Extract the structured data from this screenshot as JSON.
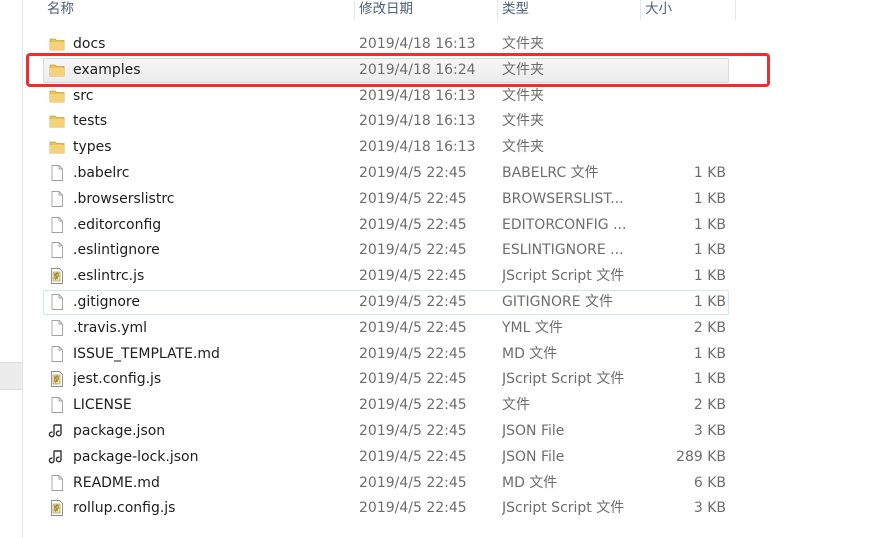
{
  "columns": {
    "name": "名称",
    "date": "修改日期",
    "type": "类型",
    "size": "大小"
  },
  "files": [
    {
      "name": "docs",
      "date": "2019/4/18 16:13",
      "type": "文件夹",
      "size": "",
      "icon": "folder-icon",
      "state": "normal"
    },
    {
      "name": "examples",
      "date": "2019/4/18 16:24",
      "type": "文件夹",
      "size": "",
      "icon": "folder-icon",
      "state": "selected"
    },
    {
      "name": "src",
      "date": "2019/4/18 16:13",
      "type": "文件夹",
      "size": "",
      "icon": "folder-icon",
      "state": "normal"
    },
    {
      "name": "tests",
      "date": "2019/4/18 16:13",
      "type": "文件夹",
      "size": "",
      "icon": "folder-icon",
      "state": "normal"
    },
    {
      "name": "types",
      "date": "2019/4/18 16:13",
      "type": "文件夹",
      "size": "",
      "icon": "folder-icon",
      "state": "normal"
    },
    {
      "name": ".babelrc",
      "date": "2019/4/5 22:45",
      "type": "BABELRC 文件",
      "size": "1 KB",
      "icon": "blank-file-icon",
      "state": "normal"
    },
    {
      "name": ".browserslistrc",
      "date": "2019/4/5 22:45",
      "type": "BROWSERSLIST...",
      "size": "1 KB",
      "icon": "blank-file-icon",
      "state": "normal"
    },
    {
      "name": ".editorconfig",
      "date": "2019/4/5 22:45",
      "type": "EDITORCONFIG ...",
      "size": "1 KB",
      "icon": "blank-file-icon",
      "state": "normal"
    },
    {
      "name": ".eslintignore",
      "date": "2019/4/5 22:45",
      "type": "ESLINTIGNORE ...",
      "size": "1 KB",
      "icon": "blank-file-icon",
      "state": "normal"
    },
    {
      "name": ".eslintrc.js",
      "date": "2019/4/5 22:45",
      "type": "JScript Script 文件",
      "size": "1 KB",
      "icon": "script-file-icon",
      "state": "normal"
    },
    {
      "name": ".gitignore",
      "date": "2019/4/5 22:45",
      "type": "GITIGNORE 文件",
      "size": "1 KB",
      "icon": "blank-file-icon",
      "state": "hover"
    },
    {
      "name": ".travis.yml",
      "date": "2019/4/5 22:45",
      "type": "YML 文件",
      "size": "2 KB",
      "icon": "blank-file-icon",
      "state": "normal"
    },
    {
      "name": "ISSUE_TEMPLATE.md",
      "date": "2019/4/5 22:45",
      "type": "MD 文件",
      "size": "1 KB",
      "icon": "blank-file-icon",
      "state": "normal"
    },
    {
      "name": "jest.config.js",
      "date": "2019/4/5 22:45",
      "type": "JScript Script 文件",
      "size": "1 KB",
      "icon": "script-file-icon",
      "state": "normal"
    },
    {
      "name": "LICENSE",
      "date": "2019/4/5 22:45",
      "type": "文件",
      "size": "2 KB",
      "icon": "blank-file-icon",
      "state": "normal"
    },
    {
      "name": "package.json",
      "date": "2019/4/5 22:45",
      "type": "JSON File",
      "size": "3 KB",
      "icon": "json-file-icon",
      "state": "normal"
    },
    {
      "name": "package-lock.json",
      "date": "2019/4/5 22:45",
      "type": "JSON File",
      "size": "289 KB",
      "icon": "json-file-icon",
      "state": "normal"
    },
    {
      "name": "README.md",
      "date": "2019/4/5 22:45",
      "type": "MD 文件",
      "size": "6 KB",
      "icon": "blank-file-icon",
      "state": "normal"
    },
    {
      "name": "rollup.config.js",
      "date": "2019/4/5 22:45",
      "type": "JScript Script 文件",
      "size": "3 KB",
      "icon": "script-file-icon",
      "state": "normal"
    }
  ],
  "colors": {
    "annotation": "#e8312e",
    "folder": "#e9c25b",
    "header_text": "#4c607a"
  }
}
